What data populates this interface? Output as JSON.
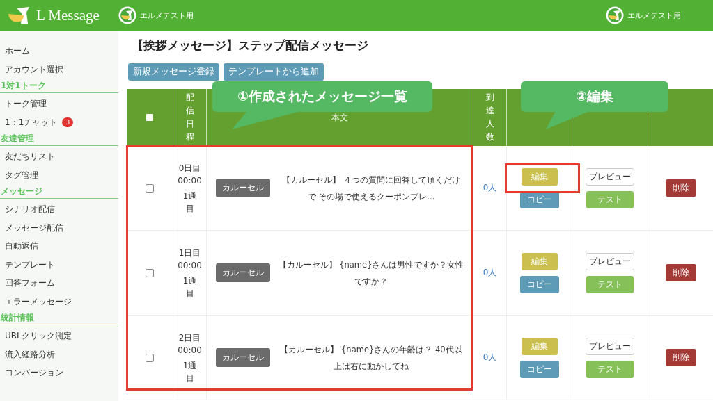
{
  "header": {
    "logo_text": "L Message",
    "account_name": "エルメテスト用",
    "right_account_name": "エルメテスト用"
  },
  "sidebar": {
    "items": [
      {
        "label": "ホーム"
      },
      {
        "label": "アカウント選択"
      }
    ],
    "sections": [
      {
        "title": "1対1トーク",
        "items": [
          {
            "label": "トーク管理"
          },
          {
            "label": "1：1チャット",
            "badge": "3"
          }
        ]
      },
      {
        "title": "友達管理",
        "items": [
          {
            "label": "友だちリスト"
          },
          {
            "label": "タグ管理"
          }
        ]
      },
      {
        "title": "メッセージ",
        "items": [
          {
            "label": "シナリオ配信"
          },
          {
            "label": "メッセージ配信"
          },
          {
            "label": "自動返信"
          },
          {
            "label": "テンプレート"
          },
          {
            "label": "回答フォーム"
          },
          {
            "label": "エラーメッセージ"
          }
        ]
      },
      {
        "title": "統計情報",
        "items": [
          {
            "label": "URLクリック測定"
          },
          {
            "label": "流入経路分析"
          },
          {
            "label": "コンバージョン"
          }
        ]
      }
    ]
  },
  "title": "【挨拶メッセージ】ステップ配信メッセージ",
  "buttons": [
    "新規メッセージ登録",
    "テンプレートから追加"
  ],
  "table": {
    "header_checked": false,
    "columns": [
      "配信日程",
      "本文",
      "到達人数"
    ],
    "rows": [
      {
        "checked": false,
        "schedule": "0日目 00:00",
        "count": "1通目",
        "tag": "カルーセル",
        "text": "【カルーセル】 ４つの質問に回答して頂くだけで その場で使えるクーポンプレ...",
        "reach": "0人",
        "actions": [
          {
            "kind": "edit",
            "label": "編集"
          },
          {
            "kind": "copy",
            "label": "コピー"
          },
          {
            "kind": "preview",
            "label": "プレビュー"
          },
          {
            "kind": "test",
            "label": "テスト"
          },
          {
            "kind": "delete",
            "label": "削除"
          }
        ]
      },
      {
        "checked": false,
        "schedule": "1日目 00:00",
        "count": "1通目",
        "tag": "カルーセル",
        "text": "【カルーセル】 {name}さんは男性ですか？女性ですか？",
        "reach": "0人",
        "actions": [
          {
            "kind": "edit",
            "label": "編集"
          },
          {
            "kind": "copy",
            "label": "コピー"
          },
          {
            "kind": "preview",
            "label": "プレビュー"
          },
          {
            "kind": "test",
            "label": "テスト"
          },
          {
            "kind": "delete",
            "label": "削除"
          }
        ]
      },
      {
        "checked": false,
        "schedule": "2日目 00:00",
        "count": "1通目",
        "tag": "カルーセル",
        "text": "【カルーセル】 {name}さんの年齢は？ 40代以上は右に動かしてね",
        "reach": "0人",
        "actions": [
          {
            "kind": "edit",
            "label": "編集"
          },
          {
            "kind": "copy",
            "label": "コピー"
          },
          {
            "kind": "preview",
            "label": "プレビュー"
          },
          {
            "kind": "test",
            "label": "テスト"
          },
          {
            "kind": "delete",
            "label": "削除"
          }
        ]
      }
    ]
  },
  "callouts": [
    {
      "text": "①作成されたメッセージ一覧"
    },
    {
      "text": "②編集"
    }
  ],
  "annotations": {
    "rows_box": true,
    "edit_box": true
  }
}
